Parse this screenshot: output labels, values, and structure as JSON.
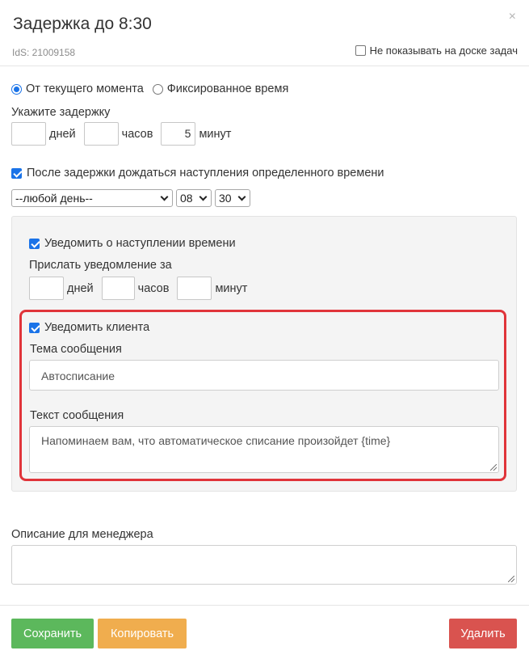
{
  "header": {
    "title": "Задержка до 8:30",
    "close_symbol": "×",
    "ids_text": "IdS: 21009158",
    "hide_on_board_label": "Не показывать на доске задач",
    "hide_on_board_checked": false
  },
  "mode": {
    "options": [
      {
        "label": "От текущего момента",
        "checked": true
      },
      {
        "label": "Фиксированное время",
        "checked": false
      }
    ]
  },
  "delay": {
    "label": "Укажите задержку",
    "days_value": "",
    "days_unit": "дней",
    "hours_value": "",
    "hours_unit": "часов",
    "minutes_value": "5",
    "minutes_unit": "минут"
  },
  "wait_until": {
    "label": "После задержки дождаться наступления определенного времени",
    "checked": true,
    "day_select": "--любой день--",
    "hour_select": "08",
    "minute_select": "30"
  },
  "notify_time": {
    "label": "Уведомить о наступлении времени",
    "checked": true,
    "send_label": "Прислать уведомление за",
    "days_value": "",
    "days_unit": "дней",
    "hours_value": "",
    "hours_unit": "часов",
    "minutes_value": "",
    "minutes_unit": "минут"
  },
  "notify_client": {
    "label": "Уведомить клиента",
    "checked": true,
    "subject_label": "Тема сообщения",
    "subject_value": "Автосписание",
    "text_label": "Текст сообщения",
    "text_value": "Напоминаем вам, что автоматическое списание произойдет  {time}",
    "highlight_color": "#e0343a"
  },
  "manager_description": {
    "label": "Описание для менеджера",
    "value": ""
  },
  "buttons": {
    "save": "Сохранить",
    "copy": "Копировать",
    "delete": "Удалить"
  },
  "colors": {
    "save": "#5cb85c",
    "copy": "#f0ad4e",
    "delete": "#d9534f",
    "accent": "#1a73e8"
  }
}
